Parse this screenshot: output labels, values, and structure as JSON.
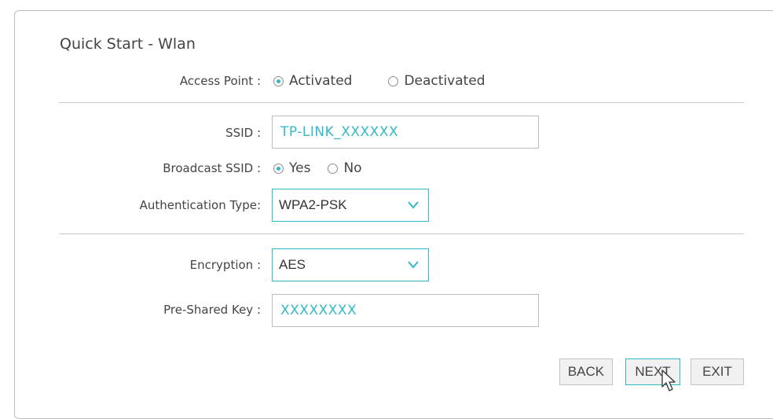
{
  "page": {
    "title": "Quick Start - Wlan"
  },
  "access_point": {
    "label": "Access Point :",
    "options": [
      {
        "label": "Activated",
        "checked": true
      },
      {
        "label": "Deactivated",
        "checked": false
      }
    ]
  },
  "ssid": {
    "label": "SSID :",
    "value": "TP-LINK_XXXXXX"
  },
  "broadcast_ssid": {
    "label": "Broadcast SSID :",
    "options": [
      {
        "label": "Yes",
        "checked": true
      },
      {
        "label": "No",
        "checked": false
      }
    ]
  },
  "auth_type": {
    "label": "Authentication Type:",
    "value": "WPA2-PSK"
  },
  "encryption": {
    "label": "Encryption :",
    "value": "AES"
  },
  "psk": {
    "label": "Pre-Shared Key :",
    "value": "XXXXXXXX"
  },
  "buttons": {
    "back": "BACK",
    "next": "NEXT",
    "exit": "EXIT"
  },
  "colors": {
    "accent": "#2fb8c6",
    "text": "#444444",
    "border": "#bdbdbd"
  },
  "icons": {
    "select_arrow": "chevron-down-icon",
    "pointer": "mouse-pointer-icon"
  }
}
